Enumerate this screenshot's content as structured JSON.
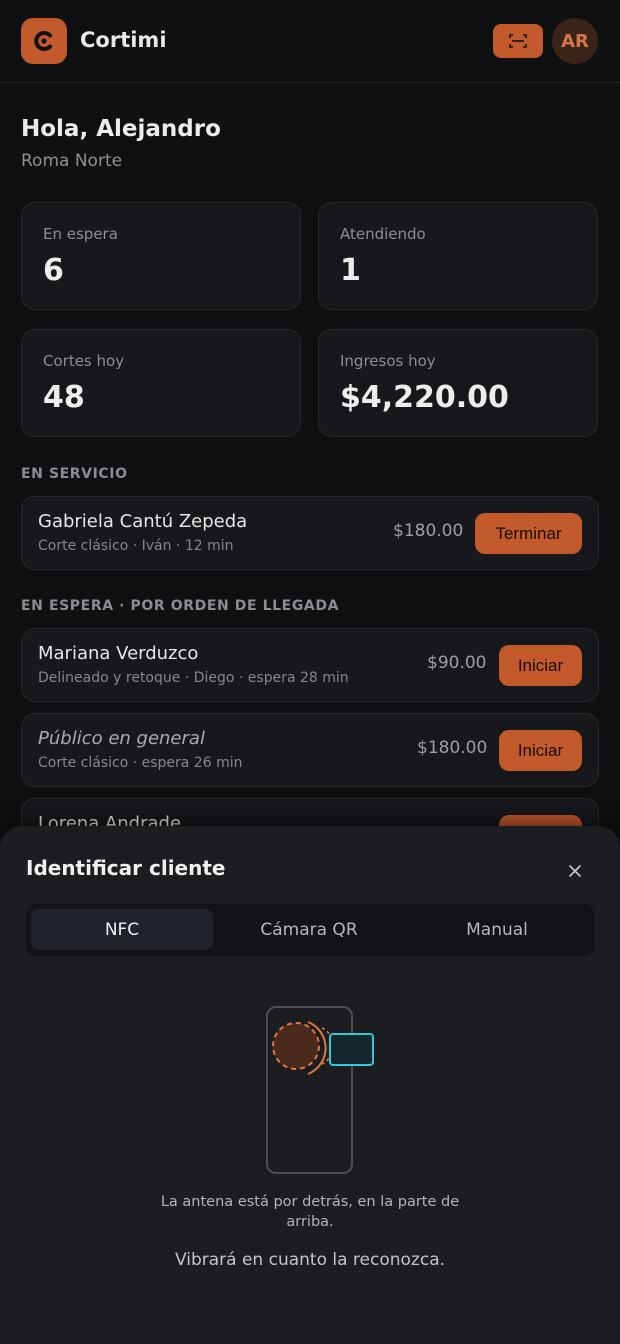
{
  "header": {
    "app_name": "Cortimi",
    "logo_icon": "logo-c-icon",
    "scan_icon": "scan-icon",
    "avatar_initials": "AR"
  },
  "greeting": {
    "title": "Hola, Alejandro",
    "location": "Roma Norte"
  },
  "stats": [
    {
      "label": "En espera",
      "value": "6"
    },
    {
      "label": "Atendiendo",
      "value": "1"
    },
    {
      "label": "Cortes hoy",
      "value": "48"
    },
    {
      "label": "Ingresos hoy",
      "value": "$4,220.00"
    }
  ],
  "in_service": {
    "title": "EN SERVICIO",
    "items": [
      {
        "name": "Gabriela Cantú Zepeda",
        "meta": "Corte clásico · Iván · 12 min",
        "price": "$180.00",
        "action": "Terminar"
      }
    ]
  },
  "waiting": {
    "title": "EN ESPERA · POR ORDEN DE LLEGADA",
    "items": [
      {
        "name": "Mariana Verduzco",
        "meta": "Delineado y retoque · Diego · espera 28 min",
        "price": "$90.00",
        "action": "Iniciar"
      },
      {
        "name": "Público en general",
        "meta": "Corte clásico · espera 26 min",
        "price": "$180.00",
        "action": "Iniciar"
      },
      {
        "name": "Lorena Andrade",
        "meta": "",
        "price": "",
        "action": ""
      }
    ]
  },
  "sheet": {
    "title": "Identificar cliente",
    "close_icon": "close-icon",
    "tabs": [
      {
        "label": "NFC",
        "active": true
      },
      {
        "label": "Cámara QR",
        "active": false
      },
      {
        "label": "Manual",
        "active": false
      }
    ],
    "hint_primary": "La antena está por detrás, en la parte de arriba.",
    "hint_secondary": "Vibrará en cuanto la reconozca."
  },
  "colors": {
    "accent": "#c25a2b",
    "background": "#0f1012",
    "card": "#16181b",
    "sheet": "#1b1d21",
    "nfc_card": "#36c8d6"
  }
}
